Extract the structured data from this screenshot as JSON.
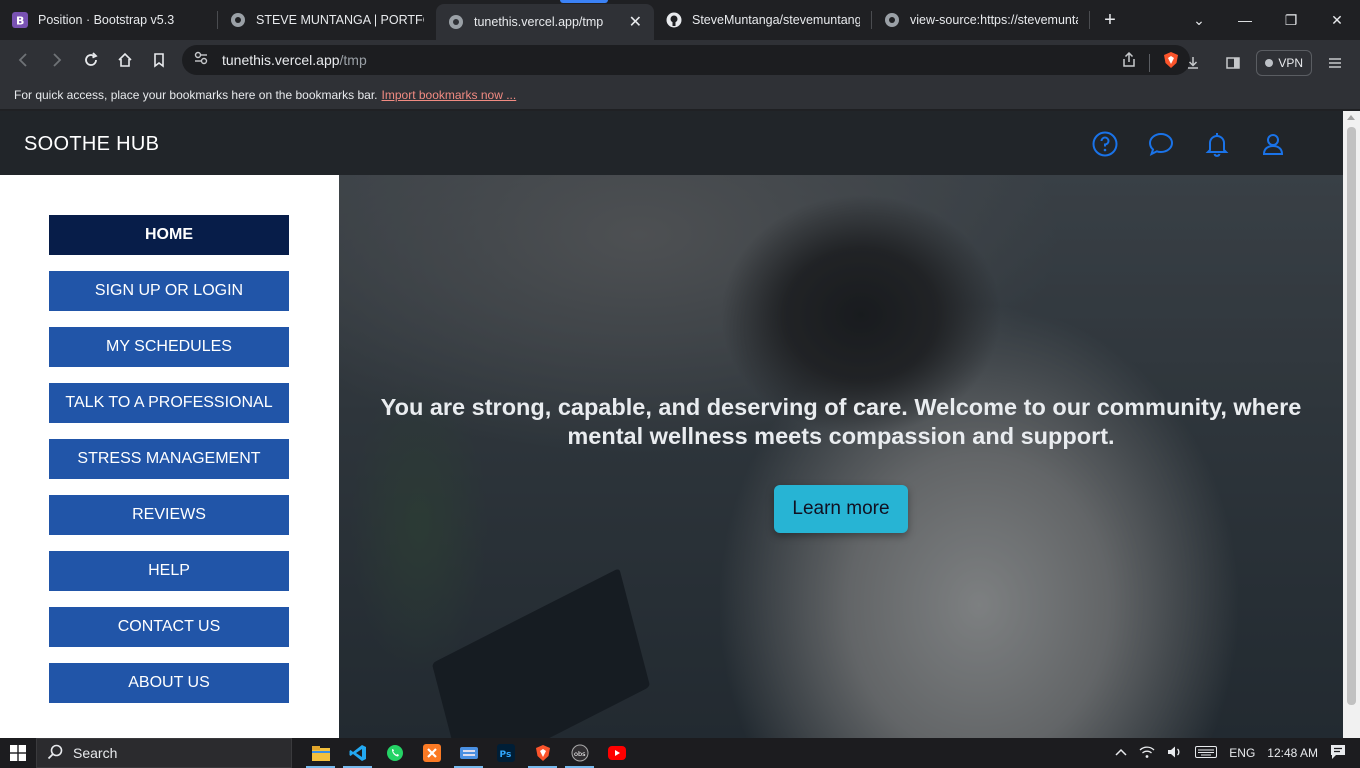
{
  "browser": {
    "tabs": [
      {
        "title": "Position · Bootstrap v5.3",
        "icon": "bootstrap-icon",
        "active": false
      },
      {
        "title": "STEVE MUNTANGA | PORTFOLIO",
        "icon": "globe-icon",
        "active": false
      },
      {
        "title": "tunethis.vercel.app/tmp",
        "icon": "globe-icon",
        "active": true
      },
      {
        "title": "SteveMuntanga/stevemuntanga",
        "icon": "github-icon",
        "active": false
      },
      {
        "title": "view-source:https://stevemuntan",
        "icon": "globe-icon",
        "active": false
      }
    ],
    "address": {
      "host": "tunethis.vercel.app",
      "path": "/tmp"
    },
    "vpn_label": "VPN",
    "bookmarks_message": "For quick access, place your bookmarks here on the bookmarks bar.",
    "bookmarks_link": "Import bookmarks now ..."
  },
  "page": {
    "brand": "SOOTHE HUB",
    "nav_icons": [
      "help-icon",
      "chat-icon",
      "bell-icon",
      "user-icon"
    ],
    "menu": [
      {
        "label": "HOME",
        "active": true
      },
      {
        "label": "SIGN UP OR LOGIN",
        "active": false
      },
      {
        "label": "MY SCHEDULES",
        "active": false
      },
      {
        "label": "TALK TO A PROFESSIONAL",
        "active": false
      },
      {
        "label": "STRESS MANAGEMENT",
        "active": false
      },
      {
        "label": "REVIEWS",
        "active": false
      },
      {
        "label": "HELP",
        "active": false
      },
      {
        "label": "CONTACT US",
        "active": false
      },
      {
        "label": "ABOUT US",
        "active": false
      }
    ],
    "hero": {
      "message": "You are strong, capable, and deserving of care. Welcome to our community, where mental wellness meets compassion and support.",
      "button": "Learn more"
    },
    "colors": {
      "menu_button": "#2155a8",
      "menu_active": "#071d49",
      "accent": "#0d6efd",
      "learn_button": "#27b4d4"
    }
  },
  "taskbar": {
    "search_label": "Search",
    "apps": [
      "file-explorer-icon",
      "vscode-icon",
      "whatsapp-icon",
      "xampp-icon",
      "keyboard-icon",
      "photoshop-icon",
      "brave-icon",
      "obs-icon",
      "youtube-icon"
    ],
    "language": "ENG",
    "time": "12:48 AM"
  }
}
